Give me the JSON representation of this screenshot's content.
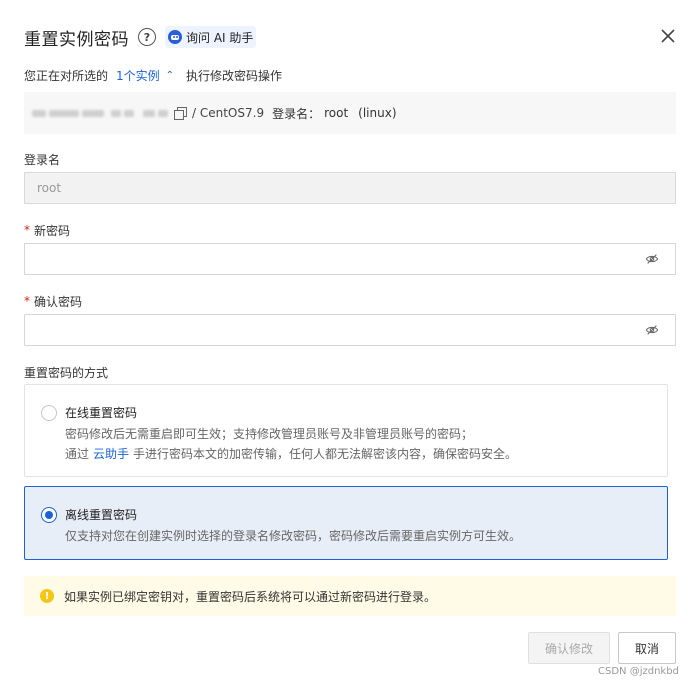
{
  "dialog": {
    "title": "重置实例密码",
    "help_icon": "?",
    "ai_assistant_label": "询问 AI 助手"
  },
  "subline": {
    "prefix": "您正在对所选的",
    "instance_count_link": "1个实例",
    "suffix": "执行修改密码操作"
  },
  "instance": {
    "os": "/ CentOS7.9",
    "login_label": "登录名：",
    "login_value": "root",
    "os_type": "(linux)"
  },
  "form": {
    "login_label": "登录名",
    "login_value": "root",
    "new_password_label": "新密码",
    "new_password_value": "",
    "confirm_password_label": "确认密码",
    "confirm_password_value": "",
    "method_label": "重置密码的方式"
  },
  "options": [
    {
      "title": "在线重置密码",
      "desc1": "密码修改后无需重启即可生效；支持修改管理员账号及非管理员账号的密码；",
      "desc2_prefix": "通过",
      "desc2_link": "云助手",
      "desc2_suffix": "手进行密码本文的加密传输，任何人都无法解密该内容，确保密码安全。",
      "selected": false
    },
    {
      "title": "离线重置密码",
      "desc1": "仅支持对您在创建实例时选择的登录名修改密码，密码修改后需要重启实例方可生效。",
      "selected": true
    }
  ],
  "notice": {
    "text": "如果实例已绑定密钥对，重置密码后系统将可以通过新密码进行登录。"
  },
  "buttons": {
    "confirm": "确认修改",
    "cancel": "取消"
  },
  "watermark": "CSDN @jzdnkbd",
  "colors": {
    "accent": "#1b63d6",
    "selected_bg": "#e8eef8",
    "notice_bg": "#fffbe6",
    "warning": "#f5c518",
    "required": "#d9230f"
  }
}
